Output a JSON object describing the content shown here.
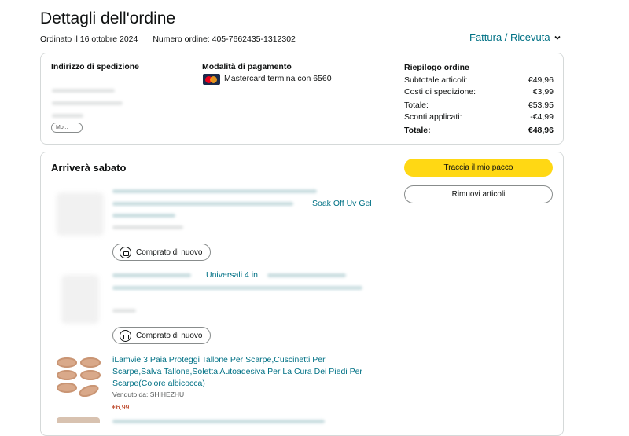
{
  "page": {
    "title": "Dettagli dell'ordine",
    "order_date": "Ordinato il 16 ottobre 2024",
    "order_number": "Numero ordine: 405-7662435-1312302",
    "invoice_link": "Fattura / Ricevuta"
  },
  "shipping": {
    "label": "Indirizzo di spedizione",
    "pill": "Mo..."
  },
  "payment": {
    "label": "Modalità di pagamento",
    "method": "Mastercard  termina con 6560"
  },
  "summary": {
    "label": "Riepilogo ordine",
    "rows": [
      {
        "label": "Subtotale articoli:",
        "value": "€49,96"
      },
      {
        "label": "Costi di spedizione:",
        "value": "€3,99"
      },
      {
        "label": "Totale:",
        "value": "€53,95"
      },
      {
        "label": "Sconti applicati:",
        "value": "-€4,99"
      }
    ],
    "grand_total_label": "Totale:",
    "grand_total_value": "€48,96"
  },
  "shipment": {
    "arrival": "Arriverà sabato",
    "track_button": "Traccia il mio pacco",
    "remove_button": "Rimuovi articoli",
    "rebuy_label": "Comprato di nuovo",
    "items": [
      {
        "title_visible": "Soak Off Uv Gel",
        "rebuy": "Comprato di nuovo"
      },
      {
        "title_visible": "Universali 4 in",
        "rebuy": "Comprato di nuovo"
      },
      {
        "title": "iLamvie 3 Paia Proteggi Tallone Per Scarpe,Cuscinetti Per Scarpe,Salva Tallone,Soletta Autoadesiva Per La Cura Dei Piedi Per Scarpe(Colore albicocca)",
        "seller": "Venduto da: SHIHEZHU",
        "price": "€6,99"
      }
    ]
  },
  "colors": {
    "link": "#007185",
    "track_button": "#ffd814",
    "price": "#b12704",
    "border": "#d5d9d9"
  }
}
